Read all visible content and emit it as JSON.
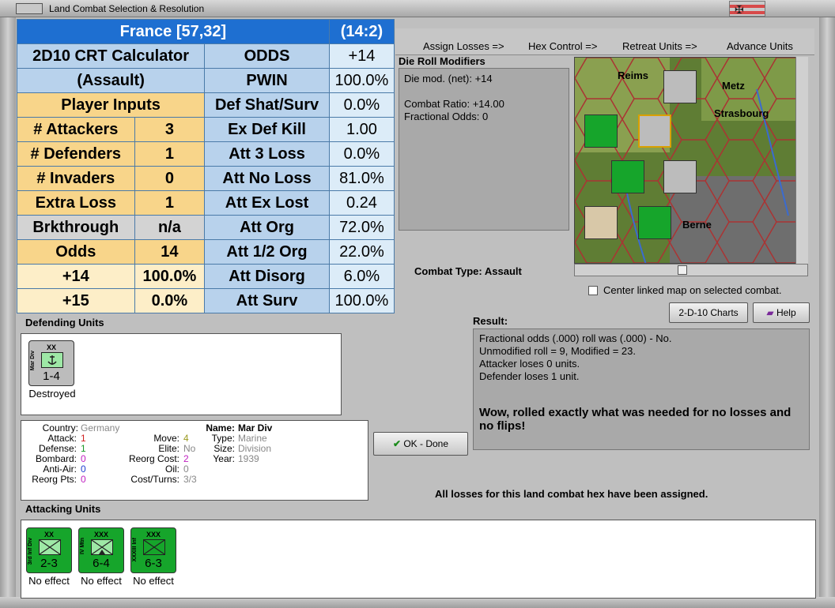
{
  "window": {
    "title": "Land Combat Selection & Resolution"
  },
  "crt": {
    "header_left": "France [57,32]",
    "header_right": "(14:2)",
    "calc_title_1": "2D10 CRT Calculator",
    "calc_title_2": "(Assault)",
    "player_inputs": "Player Inputs",
    "rows_left": [
      {
        "label": "# Attackers",
        "value": "3"
      },
      {
        "label": "# Defenders",
        "value": "1"
      },
      {
        "label": "# Invaders",
        "value": "0"
      },
      {
        "label": "Extra Loss",
        "value": "1"
      },
      {
        "label": "Brkthrough",
        "value": "n/a"
      },
      {
        "label": "Odds",
        "value": "14"
      },
      {
        "label": "+14",
        "value": "100.0%"
      },
      {
        "label": "+15",
        "value": "0.0%"
      }
    ],
    "rows_right": [
      {
        "label": "ODDS",
        "value": "+14"
      },
      {
        "label": "PWIN",
        "value": "100.0%"
      },
      {
        "label": "Def Shat/Surv",
        "value": "0.0%"
      },
      {
        "label": "Ex Def Kill",
        "value": "1.00"
      },
      {
        "label": "Att 3 Loss",
        "value": "0.0%"
      },
      {
        "label": "Att No Loss",
        "value": "81.0%"
      },
      {
        "label": "Att Ex Lost",
        "value": "0.24"
      },
      {
        "label": "Att Org",
        "value": "72.0%"
      },
      {
        "label": "Att 1/2 Org",
        "value": "22.0%"
      },
      {
        "label": "Att Disorg",
        "value": "6.0%"
      },
      {
        "label": "Att Surv",
        "value": "100.0%"
      }
    ]
  },
  "nav": {
    "assign_losses": "Assign Losses =>",
    "hex_control": "Hex Control =>",
    "retreat_units": "Retreat Units =>",
    "advance_units": "Advance Units"
  },
  "die_roll": {
    "heading": "Die Roll Modifiers",
    "line1": "Die mod. (net): +14",
    "line2": "Combat Ratio: +14.00",
    "line3": "Fractional Odds: 0"
  },
  "combat_type": {
    "label": "Combat Type:",
    "value": "Assault"
  },
  "map": {
    "cities": [
      "Reims",
      "Metz",
      "Strasbourg",
      "Berne"
    ],
    "center_checkbox_label": "Center linked map on selected combat.",
    "center_checked": false
  },
  "buttons": {
    "charts": "2-D-10 Charts",
    "help": "Help",
    "ok_done": "OK - Done"
  },
  "defending": {
    "heading": "Defending Units",
    "units": [
      {
        "size": "XX",
        "name": "Mar Div",
        "stats": "1-4",
        "status": "Destroyed"
      }
    ]
  },
  "unit_info": {
    "country_label": "Country:",
    "country": "Germany",
    "attack_label": "Attack:",
    "attack": "1",
    "defense_label": "Defense:",
    "defense": "1",
    "bombard_label": "Bombard:",
    "bombard": "0",
    "antiair_label": "Anti-Air:",
    "antiair": "0",
    "reorg_pts_label": "Reorg Pts:",
    "reorg_pts": "0",
    "move_label": "Move:",
    "move": "4",
    "elite_label": "Elite:",
    "elite": "No",
    "reorg_cost_label": "Reorg Cost:",
    "reorg_cost": "2",
    "oil_label": "Oil:",
    "oil": "0",
    "cost_turns_label": "Cost/Turns:",
    "cost_turns": "3/3",
    "name_label": "Name:",
    "name": "Mar Div",
    "type_label": "Type:",
    "type": "Marine",
    "size_label": "Size:",
    "size": "Division",
    "year_label": "Year:",
    "year": "1939"
  },
  "result": {
    "heading": "Result:",
    "line1": "Fractional odds (.000) roll was (.000)  - No.",
    "line2": "Unmodified roll = 9, Modified = 23.",
    "line3": "Attacker loses 0 units.",
    "line4": "Defender loses 1 unit.",
    "message": "Wow, rolled exactly what was needed for no losses and no flips!"
  },
  "all_losses_msg": "All losses for this land combat hex have been assigned.",
  "attacking": {
    "heading": "Attacking Units",
    "units": [
      {
        "size": "XX",
        "name": "3rd Inf Div",
        "stats": "2-3",
        "status": "No effect"
      },
      {
        "size": "XXX",
        "name": "IV Mtn",
        "stats": "6-4",
        "status": "No effect"
      },
      {
        "size": "XXX",
        "name": "XXXIII Inf",
        "stats": "6-3",
        "status": "No effect"
      }
    ]
  },
  "colors": {
    "crt_header": "#1e6fd1",
    "crt_blue": "#b8d2ec",
    "crt_yellow": "#f8d58a",
    "unit_green": "#16a52b",
    "unit_grey": "#bcbcbc"
  },
  "icons": [
    "system-menu-icon",
    "german-war-flag-icon",
    "checkmark-icon",
    "help-book-icon",
    "infantry-symbol-icon",
    "marine-anchor-icon"
  ]
}
